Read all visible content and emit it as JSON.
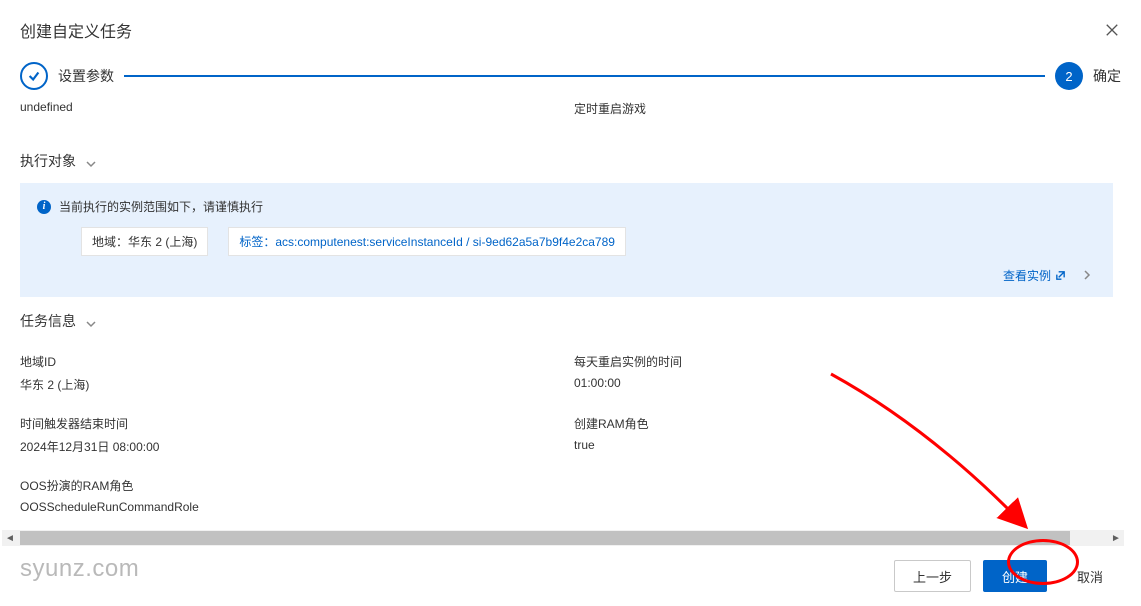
{
  "modal": {
    "title": "创建自定义任务"
  },
  "stepper": {
    "step1_label": "设置参数",
    "step2_number": "2",
    "step2_label": "确定"
  },
  "subheader": {
    "left": "undefined",
    "right": "定时重启游戏"
  },
  "sections": {
    "execution_target": {
      "title": "执行对象",
      "notice": "当前执行的实例范围如下，请谨慎执行",
      "region_tag_prefix": "地域：",
      "region_tag_value": "华东 2 (上海)",
      "label_tag_prefix": "标签：",
      "label_tag_value": "acs:computenest:serviceInstanceId / si-9ed62a5a7b9f4e2ca789",
      "view_instances": "查看实例"
    },
    "task_info": {
      "title": "任务信息",
      "items": [
        {
          "label": "地域ID",
          "value": "华东 2 (上海)"
        },
        {
          "label": "每天重启实例的时间",
          "value": "01:00:00"
        },
        {
          "label": "时间触发器结束时间",
          "value": "2024年12月31日 08:00:00"
        },
        {
          "label": "创建RAM角色",
          "value": "true"
        },
        {
          "label": "OOS扮演的RAM角色",
          "value": "OOSScheduleRunCommandRole"
        }
      ]
    }
  },
  "footer": {
    "prev": "上一步",
    "create": "创建",
    "cancel": "取消"
  },
  "watermark": "syunz.com"
}
